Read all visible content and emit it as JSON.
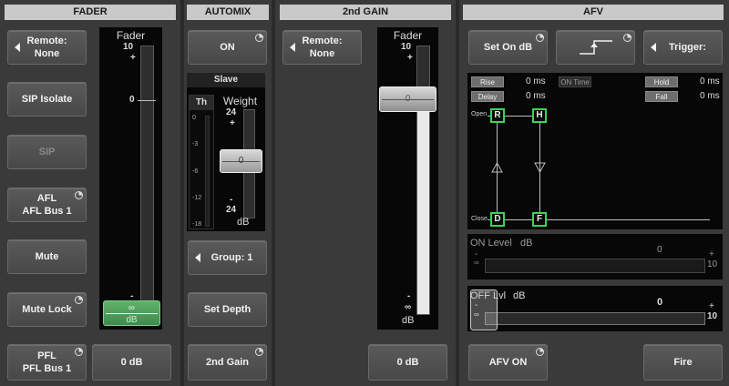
{
  "sections": {
    "fader": "FADER",
    "automix": "AUTOMIX",
    "second_gain": "2nd GAIN",
    "afv": "AFV"
  },
  "fader": {
    "remote_label": "Remote:",
    "remote_value": "None",
    "sip_isolate": "SIP Isolate",
    "sip": "SIP",
    "afl_label": "AFL",
    "afl_value": "AFL Bus 1",
    "mute": "Mute",
    "mute_lock": "Mute Lock",
    "pfl_label": "PFL",
    "pfl_value": "PFL Bus 1",
    "gain_readout": "0 dB",
    "strip_title": "Fader",
    "scale_top": "10",
    "scale_plus": "+",
    "scale_zero": "0",
    "scale_minus": "-",
    "knob_symbol": "∞",
    "knob_unit": "dB",
    "level_fraction": 0.0
  },
  "automix": {
    "on_label": "ON",
    "slave_label": "Slave",
    "th_label": "Th",
    "th_ticks": [
      "0",
      "-3",
      "-6",
      "-12",
      "-18"
    ],
    "weight_label": "Weight",
    "weight_top": "24",
    "weight_plus": "+",
    "weight_knob": "0",
    "weight_minus": "-",
    "weight_bottom": "24",
    "weight_unit": "dB",
    "group_label": "Group: 1",
    "set_depth": "Set Depth",
    "second_gain_btn": "2nd Gain"
  },
  "second_gain": {
    "remote_label": "Remote:",
    "remote_value": "None",
    "strip_title": "Fader",
    "scale_top": "10",
    "scale_plus": "+",
    "knob_value": "0",
    "scale_minus": "-",
    "scale_inf": "∞",
    "scale_unit": "dB",
    "gain_readout": "0 dB"
  },
  "afv": {
    "set_on_db": "Set On dB",
    "trigger_label": "Trigger:",
    "rise_label": "Rise",
    "rise_value": "0 ms",
    "delay_label": "Delay",
    "delay_value": "0 ms",
    "on_time_label": "ON Time",
    "hold_label": "Hold",
    "hold_value": "0 ms",
    "fall_label": "Fall",
    "fall_value": "0 ms",
    "open_label": "Open",
    "close_label": "Close",
    "node_r": "R",
    "node_h": "H",
    "node_d": "D",
    "node_f": "F",
    "on_level_label": "ON Level",
    "on_level_unit": "dB",
    "on_level_value": "0",
    "on_level_minus": "-",
    "on_level_inf": "∞",
    "on_level_plus": "+",
    "on_level_max": "10",
    "off_level_label": "OFF Lvl",
    "off_level_unit": "dB",
    "off_level_value": "0",
    "off_level_minus": "-",
    "off_level_inf": "∞",
    "off_level_plus": "+",
    "off_level_max": "10",
    "afv_on": "AFV ON",
    "fire": "Fire"
  },
  "colors": {
    "accent_green": "#39d55a",
    "fader_knob_green": "#4a9a58",
    "header_bg": "#c9c9c9"
  }
}
